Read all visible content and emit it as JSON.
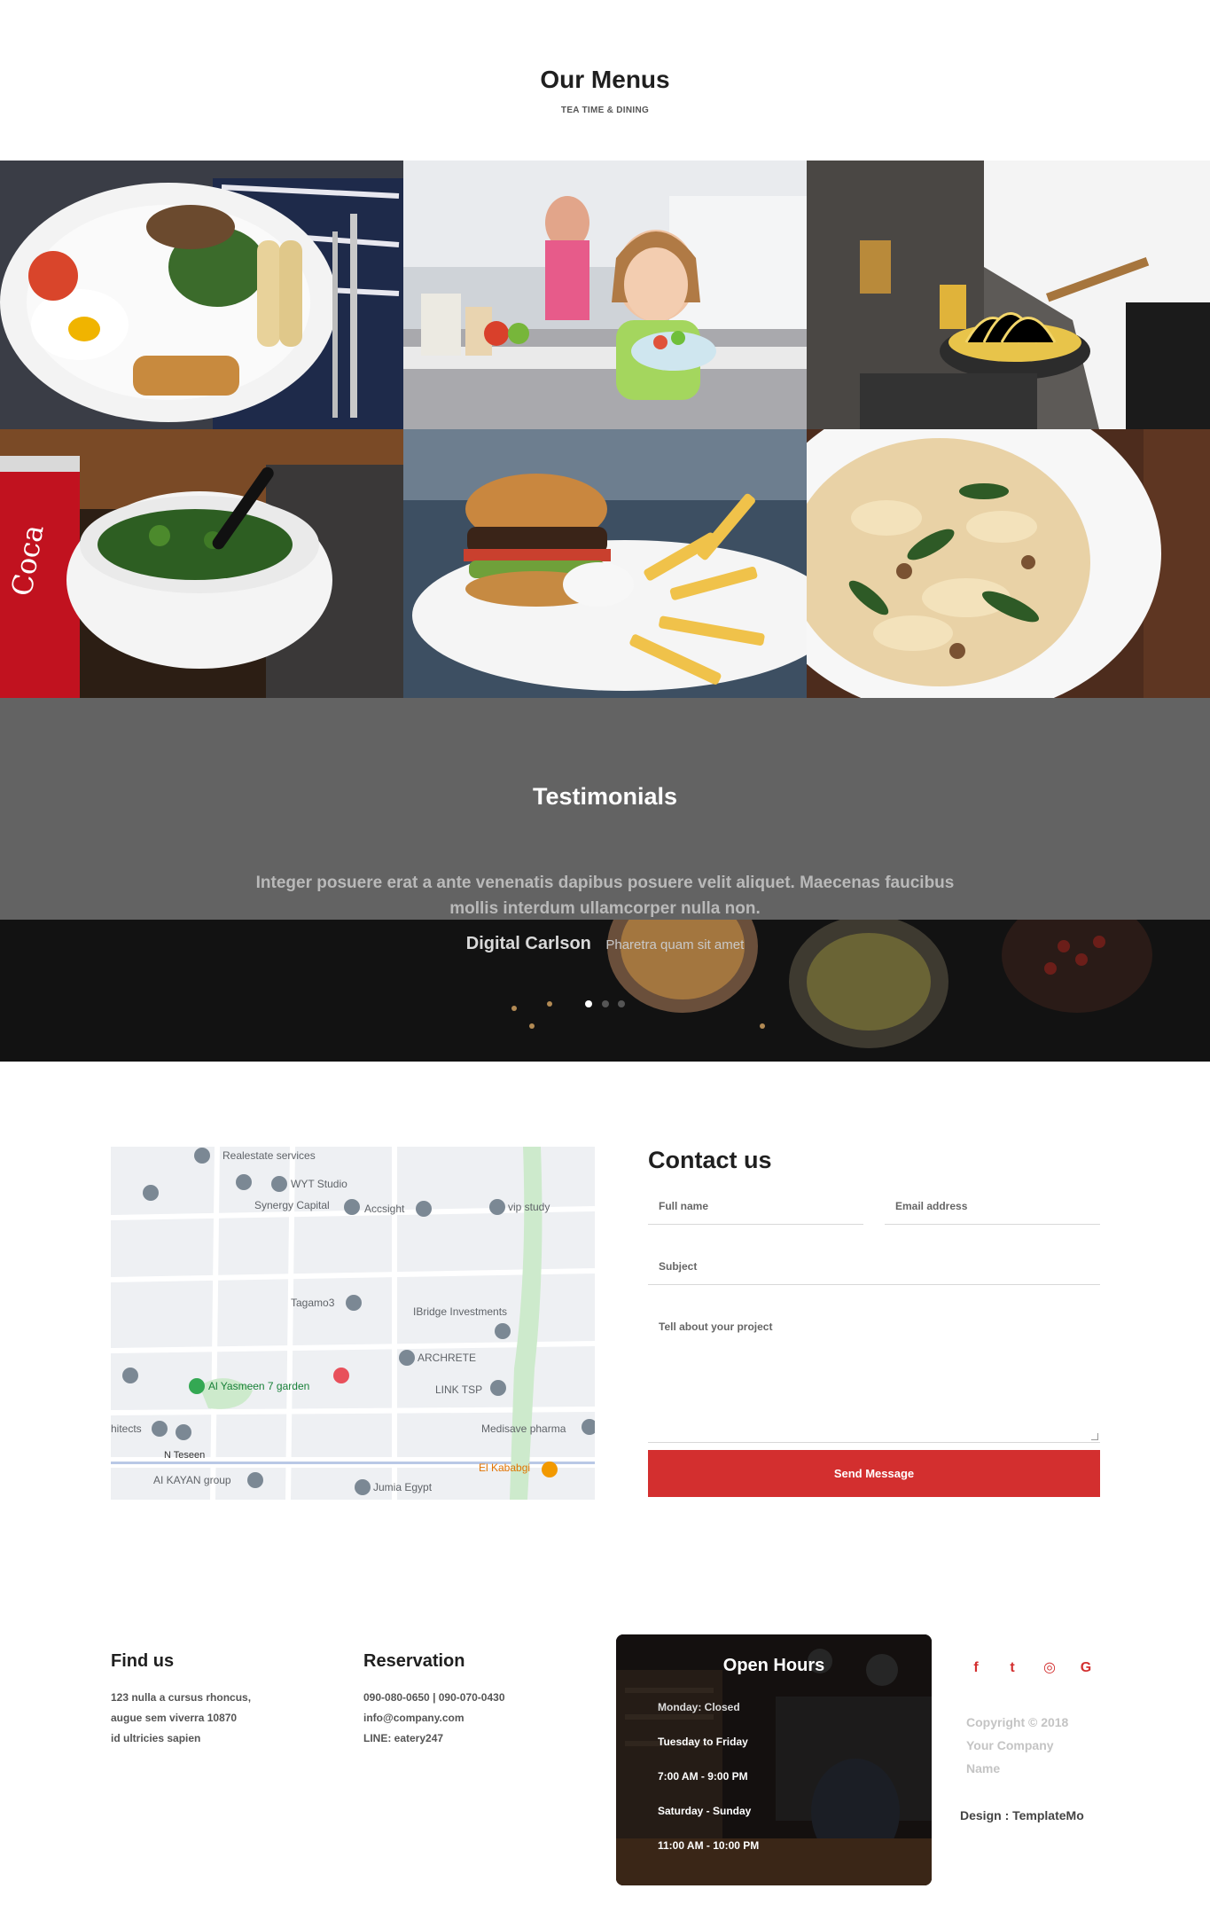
{
  "menus": {
    "title": "Our Menus",
    "subtitle": "TEA TIME & DINING",
    "images": [
      {
        "name": "breakfast-plate-image"
      },
      {
        "name": "kitchen-girl-salad-image"
      },
      {
        "name": "chef-cooking-pasta-image"
      },
      {
        "name": "salad-bowl-cola-image"
      },
      {
        "name": "burger-fries-image"
      },
      {
        "name": "pasta-plate-image"
      }
    ]
  },
  "testimonials": {
    "title": "Testimonials",
    "quote": "Integer posuere erat a ante venenatis dapibus posuere velit aliquet. Maecenas faucibus mollis interdum ullamcorper nulla non.",
    "author_name": "Digital Carlson",
    "author_role": "Pharetra quam sit amet",
    "dots": 3,
    "active_dot": 0
  },
  "map": {
    "labels": [
      "Realestate services",
      "WYT Studio",
      "Synergy Capital",
      "Accsight",
      "vip study",
      "Tagamo3",
      "IBridge Investments",
      "ARCHRETE",
      "Al Yasmeen 7 garden",
      "LINK TSP",
      "Medisave pharma",
      "hitects",
      "N Teseen",
      "El Kababgi",
      "AI KAYAN group",
      "Jumia Egypt"
    ]
  },
  "contact": {
    "title": "Contact us",
    "full_name_placeholder": "Full name",
    "email_placeholder": "Email address",
    "subject_placeholder": "Subject",
    "message_placeholder": "Tell about your project",
    "send_label": "Send Message"
  },
  "footer": {
    "find_us": {
      "title": "Find us",
      "lines": [
        "123 nulla a cursus rhoncus,",
        "augue sem viverra 10870",
        "id ultricies sapien"
      ]
    },
    "reservation": {
      "title": "Reservation",
      "lines": [
        "090-080-0650 | 090-070-0430",
        "info@company.com",
        "LINE: eatery247"
      ]
    },
    "open_hours": {
      "title": "Open Hours",
      "lines": [
        "Monday: Closed",
        "Tuesday to Friday",
        "7:00 AM - 9:00 PM",
        "Saturday - Sunday",
        "11:00 AM - 10:00 PM"
      ]
    },
    "social": [
      {
        "icon": "facebook-icon",
        "glyph": "f"
      },
      {
        "icon": "twitter-icon",
        "glyph": "t"
      },
      {
        "icon": "instagram-icon",
        "glyph": "◎"
      },
      {
        "icon": "google-icon",
        "glyph": "G"
      }
    ],
    "copyright_lines": [
      "Copyright © 2018",
      "Your Company",
      "Name"
    ],
    "design_credit": "Design : TemplateMo"
  },
  "colors": {
    "accent": "#d32f2f",
    "testimonial_bg": "#636363",
    "heading": "#1f1f1f"
  }
}
